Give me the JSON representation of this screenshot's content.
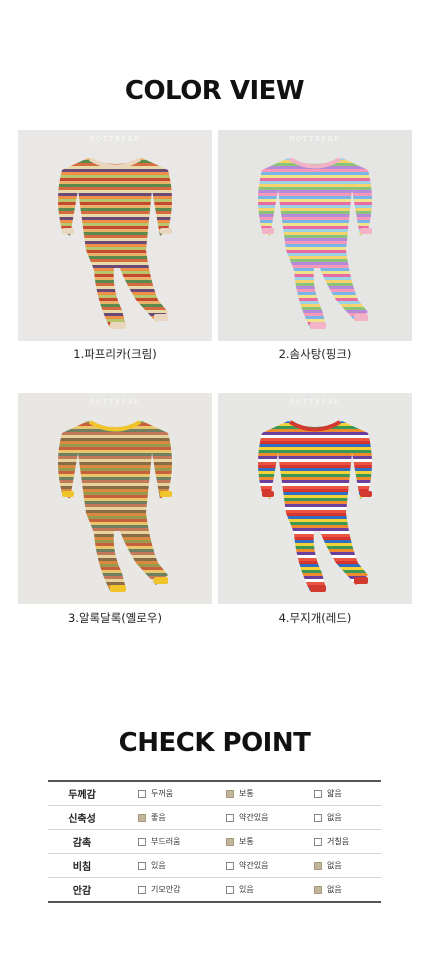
{
  "color_view": {
    "title": "COLOR VIEW",
    "brand": "DOTTBEBE",
    "items": [
      {
        "caption": "1.파프리카(크림)",
        "trim": "#ead6be",
        "stripes": [
          "#c7472f",
          "#e9b26b",
          "#5a8a4c",
          "#d56b3f",
          "#e8d9a8",
          "#6b4a78",
          "#ee8f4a",
          "#b8c66b"
        ]
      },
      {
        "caption": "2.솜사탕(핑크)",
        "trim": "#f2b3c6",
        "stripes": [
          "#e86aa7",
          "#9ad2e6",
          "#f3d36b",
          "#8cc37a",
          "#b68ad8",
          "#f49ab8",
          "#78b6e8",
          "#f0e38c"
        ]
      },
      {
        "caption": "3.알록달록(옐로우)",
        "trim": "#f1c42b",
        "stripes": [
          "#d98a3c",
          "#9a9a4e",
          "#c95f3b",
          "#e9c56c",
          "#6f7f62",
          "#c47a5a",
          "#e7d39a",
          "#8a6b4a"
        ]
      },
      {
        "caption": "4.무지개(레드)",
        "trim": "#d23a30",
        "stripes": [
          "#d8352e",
          "#2f6fc2",
          "#f3d13a",
          "#3a9a55",
          "#f08a2e",
          "#6b3fa0",
          "#ffffff",
          "#e8563f"
        ]
      }
    ]
  },
  "check_point": {
    "title": "CHECK POINT",
    "rows": [
      {
        "label": "두께감",
        "options": [
          {
            "text": "두꺼움",
            "checked": false
          },
          {
            "text": "보통",
            "checked": true
          },
          {
            "text": "얇음",
            "checked": false
          }
        ]
      },
      {
        "label": "신축성",
        "options": [
          {
            "text": "좋음",
            "checked": true
          },
          {
            "text": "약간있음",
            "checked": false
          },
          {
            "text": "없음",
            "checked": false
          }
        ]
      },
      {
        "label": "감촉",
        "options": [
          {
            "text": "부드러움",
            "checked": false
          },
          {
            "text": "보통",
            "checked": true
          },
          {
            "text": "거칠음",
            "checked": false
          }
        ]
      },
      {
        "label": "비침",
        "options": [
          {
            "text": "있음",
            "checked": false
          },
          {
            "text": "약간있음",
            "checked": false
          },
          {
            "text": "없음",
            "checked": true
          }
        ]
      },
      {
        "label": "안감",
        "options": [
          {
            "text": "기모안감",
            "checked": false
          },
          {
            "text": "있음",
            "checked": false
          },
          {
            "text": "없음",
            "checked": true
          }
        ]
      }
    ]
  }
}
